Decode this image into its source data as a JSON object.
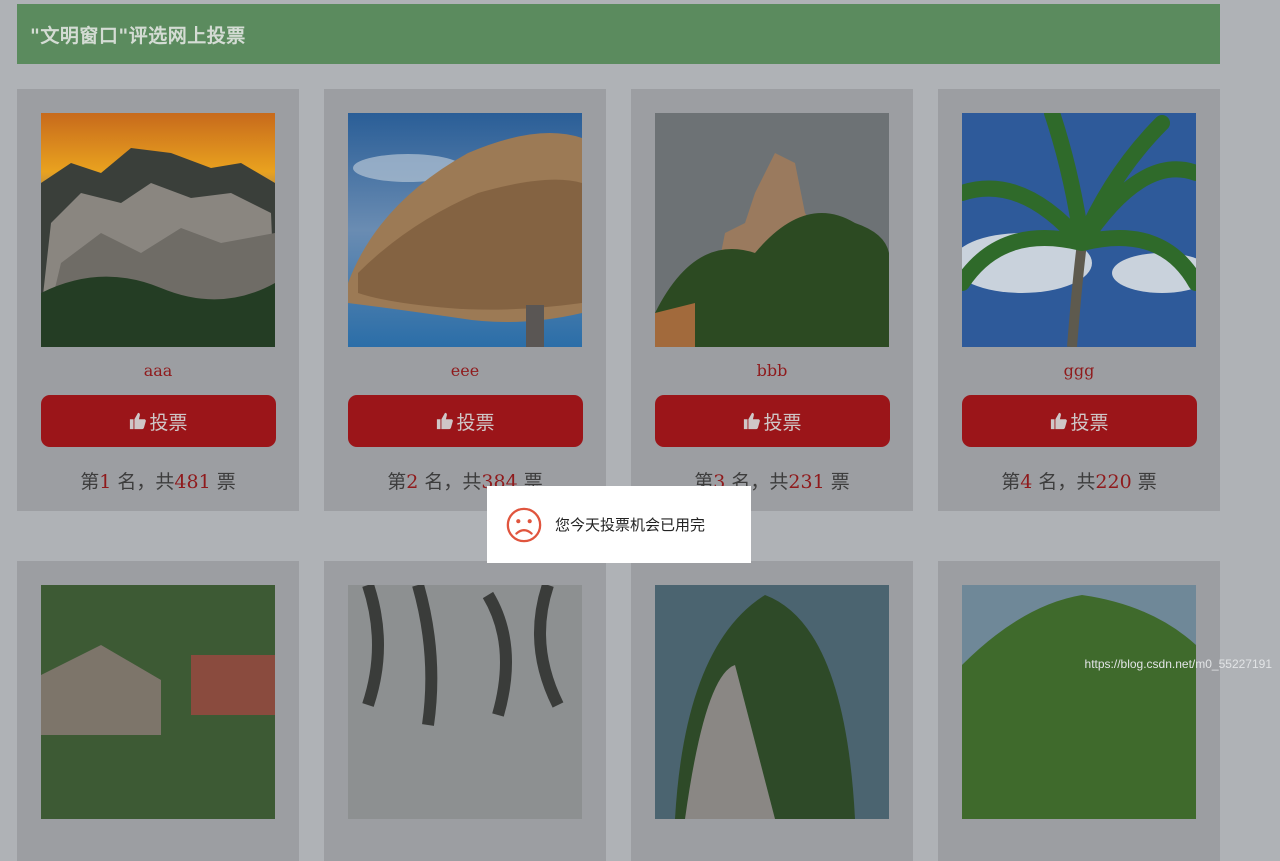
{
  "header": {
    "title": "\"文明窗口\"评选网上投票"
  },
  "cards": [
    {
      "name": "aaa",
      "vote_label": "投票",
      "rank_prefix": "第",
      "rank": "1",
      "rank_mid": " 名，共",
      "votes": "481",
      "rank_suffix": " 票"
    },
    {
      "name": "eee",
      "vote_label": "投票",
      "rank_prefix": "第",
      "rank": "2",
      "rank_mid": " 名，共",
      "votes": "384",
      "rank_suffix": " 票"
    },
    {
      "name": "bbb",
      "vote_label": "投票",
      "rank_prefix": "第",
      "rank": "3",
      "rank_mid": " 名，共",
      "votes": "231",
      "rank_suffix": " 票"
    },
    {
      "name": "ggg",
      "vote_label": "投票",
      "rank_prefix": "第",
      "rank": "4",
      "rank_mid": " 名，共",
      "votes": "220",
      "rank_suffix": " 票"
    }
  ],
  "toast": {
    "message": "您今天投票机会已用完",
    "icon": "sad-face-icon"
  },
  "watermark": {
    "text": "https://blog.csdn.net/m0_55227191"
  },
  "colors": {
    "header": "#5b8b5e",
    "button": "#9b1519",
    "accent_text": "#8f1a1c",
    "overlay_bg": "#afb2b6"
  }
}
